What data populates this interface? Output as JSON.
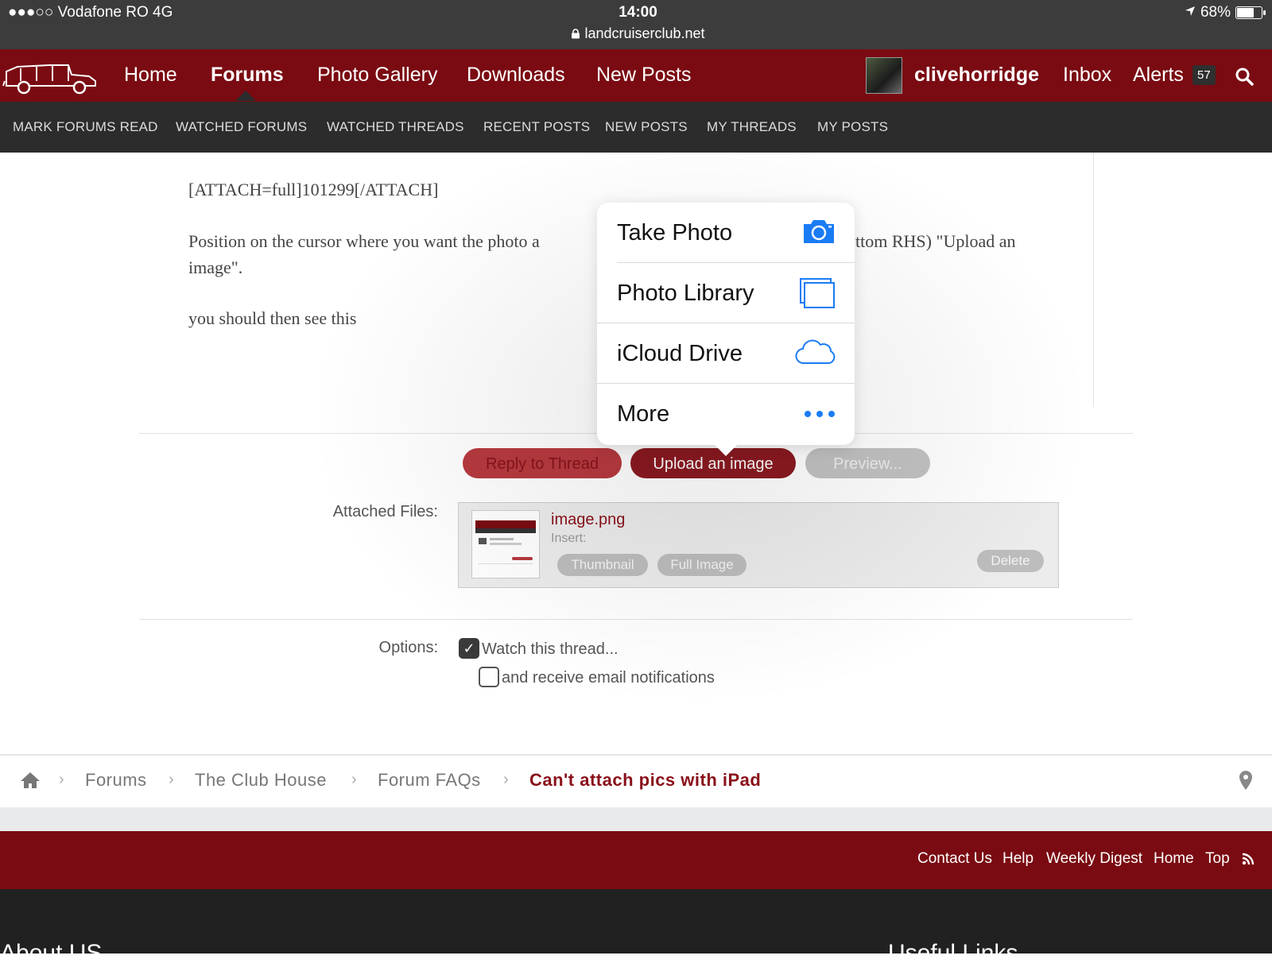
{
  "status_bar": {
    "carrier": "●●●○○ Vodafone RO   4G",
    "time": "14:00",
    "url": "landcruiserclub.net",
    "battery": "68%"
  },
  "main_nav": {
    "items": [
      "Home",
      "Forums",
      "Photo Gallery",
      "Downloads",
      "New Posts"
    ],
    "active": "Forums",
    "username": "clivehorridge",
    "inbox": "Inbox",
    "alerts": "Alerts",
    "alerts_count": "57"
  },
  "sub_nav": {
    "items": [
      "MARK FORUMS READ",
      "WATCHED FORUMS",
      "WATCHED THREADS",
      "RECENT POSTS",
      "NEW POSTS",
      "MY THREADS",
      "MY POSTS"
    ]
  },
  "post": {
    "line1": "[ATTACH=full]101299[/ATTACH]",
    "line2a": "Position on the cursor where you want the photo a",
    "line2b": "ttom RHS) \"Upload an",
    "line2c": "image\".",
    "line3": "you should then see this"
  },
  "buttons": {
    "reply": "Reply to Thread",
    "upload": "Upload an image",
    "preview": "Preview..."
  },
  "attachments": {
    "label": "Attached Files:",
    "file_name": "image.png",
    "insert_label": "Insert:",
    "thumbnail": "Thumbnail",
    "full_image": "Full Image",
    "delete": "Delete"
  },
  "options": {
    "label": "Options:",
    "watch": "Watch this thread...",
    "watch_checked": true,
    "email": "and receive email notifications",
    "email_checked": false
  },
  "popover": {
    "items": [
      {
        "label": "Take Photo",
        "icon": "camera-icon"
      },
      {
        "label": "Photo Library",
        "icon": "photo-library-icon"
      },
      {
        "label": "iCloud Drive",
        "icon": "cloud-icon"
      },
      {
        "label": "More",
        "icon": "more-icon"
      }
    ],
    "accent": "#1a7cf5"
  },
  "breadcrumb": {
    "items": [
      "Forums",
      "The Club House",
      "Forum FAQs"
    ],
    "current": "Can't attach pics with iPad"
  },
  "footer": {
    "links": [
      "Contact Us",
      "Help",
      "Weekly Digest",
      "Home",
      "Top"
    ],
    "left_heading": "About US",
    "right_heading": "Useful Links"
  },
  "colors": {
    "brand": "#7a0b12",
    "subnav": "#2c2c2c",
    "accent_link": "#8a1019"
  }
}
